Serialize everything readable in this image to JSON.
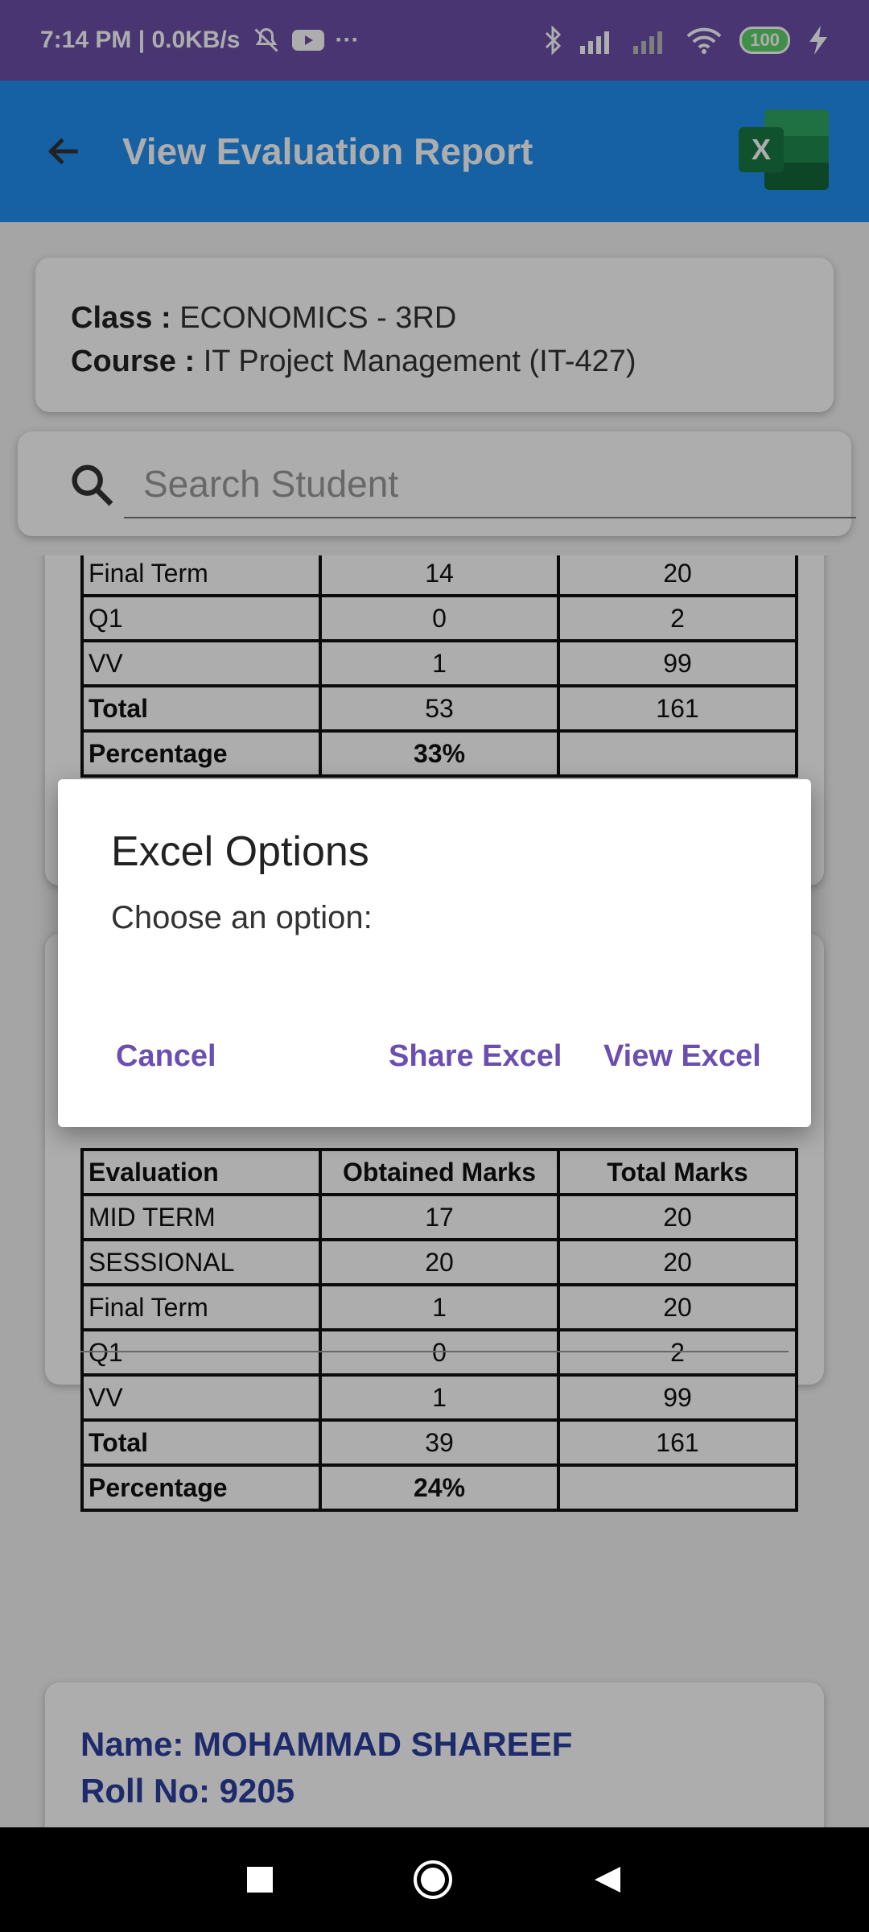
{
  "status_bar": {
    "time_speed": "7:14 PM | 0.0KB/s",
    "more": "···",
    "battery": "100"
  },
  "app_bar": {
    "title": "View Evaluation Report"
  },
  "class_info": {
    "class_label": "Class :",
    "class_value": "ECONOMICS - 3RD",
    "course_label": "Course :",
    "course_value": "IT Project Management (IT-427)"
  },
  "search": {
    "placeholder": "Search Student"
  },
  "table_top_partial": {
    "rows": [
      [
        "Final Term",
        "14",
        "20"
      ],
      [
        "Q1",
        "0",
        "2"
      ],
      [
        "VV",
        "1",
        "99"
      ],
      [
        "Total",
        "53",
        "161"
      ],
      [
        "Percentage",
        "33%",
        ""
      ]
    ]
  },
  "table_second": {
    "headers": [
      "Evaluation",
      "Obtained Marks",
      "Total Marks"
    ],
    "rows": [
      [
        "MID TERM",
        "17",
        "20"
      ],
      [
        "SESSIONAL",
        "20",
        "20"
      ],
      [
        "Final Term",
        "1",
        "20"
      ],
      [
        "Q1",
        "0",
        "2"
      ],
      [
        "VV",
        "1",
        "99"
      ],
      [
        "Total",
        "39",
        "161"
      ],
      [
        "Percentage",
        "24%",
        ""
      ]
    ]
  },
  "student_third": {
    "name": "Name: MOHAMMAD SHAREEF",
    "roll": "Roll No: 9205"
  },
  "dialog": {
    "title": "Excel Options",
    "message": "Choose an option:",
    "cancel": "Cancel",
    "share": "Share Excel",
    "view": "View Excel"
  },
  "colors": {
    "status_bar": "#6a4fa8",
    "app_bar": "#1f8ff0",
    "dialog_button": "#6b4fb0",
    "student_name": "#2c3ea0"
  },
  "icons": [
    "back-arrow-icon",
    "excel-icon",
    "search-icon",
    "silent-icon",
    "youtube-icon",
    "bluetooth-icon",
    "signal-icon",
    "wifi-icon",
    "battery-icon",
    "charging-icon",
    "nav-recents-icon",
    "nav-home-icon",
    "nav-back-icon"
  ]
}
